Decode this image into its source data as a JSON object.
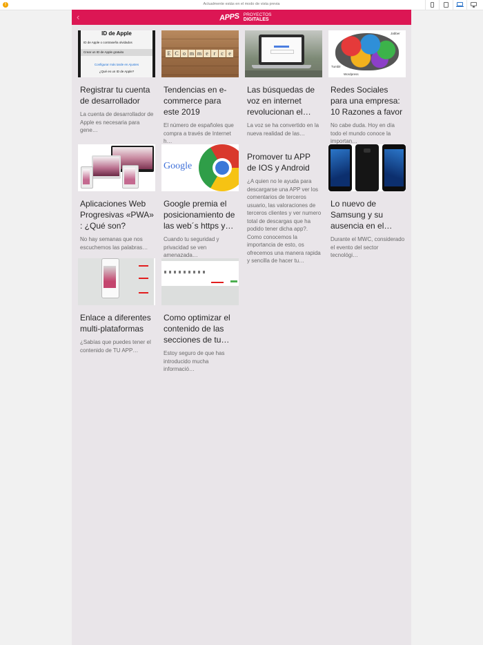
{
  "preview": {
    "message": "Actualmente estás en el modo de vista previa",
    "warning_icon": "!",
    "devices": [
      "phone",
      "tablet",
      "laptop",
      "desktop"
    ],
    "active_device": "laptop"
  },
  "header": {
    "logo_main": "APPS",
    "logo_line1": "PROYECTOS",
    "logo_line2": "DIGITALES",
    "back_icon": "‹",
    "color": "#dc1654"
  },
  "thumbs": {
    "apple_title": "ID de Apple",
    "apple_row1": "ID de Apple o contraseña olvidados",
    "apple_row2": "Crear un ID de Apple gratuito",
    "apple_link": "Configurar más tarde en Ajustes",
    "apple_q": "¿Qué es un ID de Apple?",
    "ecommerce_tiles": [
      "E",
      "C",
      "o",
      "m",
      "m",
      "e",
      "r",
      "c",
      "e"
    ],
    "google_word": "Google",
    "brain_jabber": "Jabber",
    "brain_tumblr": "Tumblr",
    "brain_wordpress": "Wordpress"
  },
  "articles": [
    {
      "title": "Registrar tu cuenta de desarrollador",
      "excerpt": "La cuenta de desarrollador de Apple es necesaria para gene…"
    },
    {
      "title": "Tendencias en e-commerce para este 2019",
      "excerpt": "El número de españoles que compra a través de Internet h…"
    },
    {
      "title": "Las búsquedas de voz en internet revolucionan el…",
      "excerpt": "La voz se ha convertido en la nueva realidad de las…"
    },
    {
      "title": "Redes Sociales para una empresa: 10 Razones a favor",
      "excerpt": "No cabe duda. Hoy en día todo el mundo conoce la importan…"
    },
    {
      "title": "Aplicaciones Web Progresivas «PWA» : ¿Qué son?",
      "excerpt": "No hay semanas que nos escuchemos las palabras…"
    },
    {
      "title": "Google premia el posicionamiento de las web´s https y…",
      "excerpt": "Cuando tu seguridad y privacidad se ven amenazada…"
    },
    {
      "title": "Promover tu APP de IOS y Android",
      "excerpt": "¿A quien no le ayuda para descargarse una APP ver los comentarios de terceros usuario, las valoraciones de terceros clientes y ver numero total de descargas que ha podido tener dicha app?. Como conocemos la importancia de esto, os ofrecemos una manera rapida y sencilla de hacer tu…"
    },
    {
      "title": "Lo nuevo de Samsung y su ausencia en el…",
      "excerpt": "Durante el MWC, considerado el evento del sector tecnológi…"
    },
    {
      "title": "Enlace a diferentes multi-plataformas",
      "excerpt": "¿Sabías que puedes tener el contenido de TU APP…"
    },
    {
      "title": "Como optimizar el contenido de las secciones de tu…",
      "excerpt": "Estoy seguro de que has introducido mucha informació…"
    }
  ]
}
